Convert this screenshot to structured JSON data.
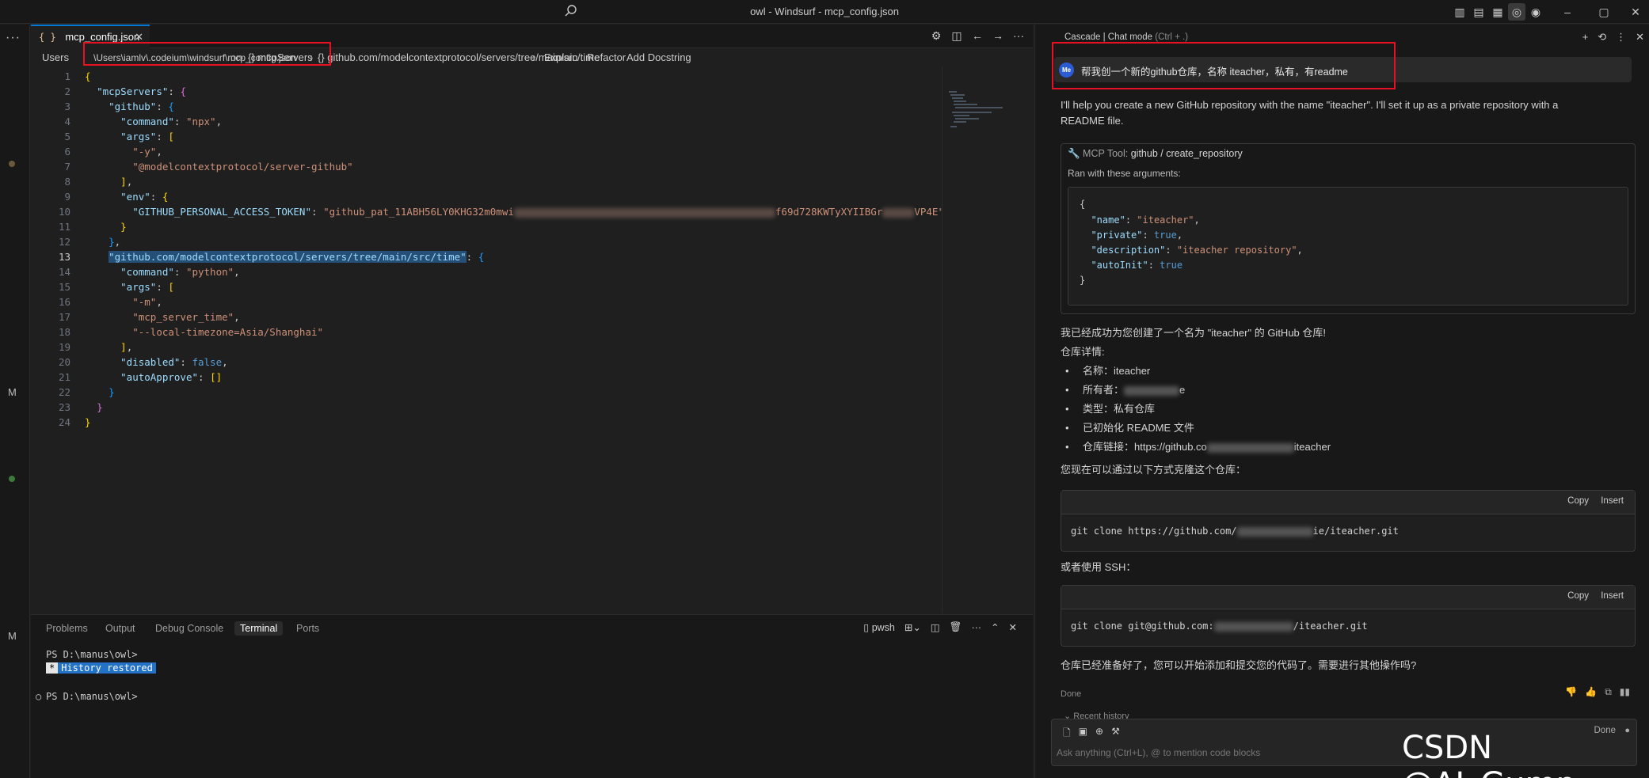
{
  "titlebar": {
    "title": "owl - Windsurf - mcp_config.json"
  },
  "activity": {
    "markers": [
      "M",
      "M"
    ]
  },
  "editor": {
    "tab": {
      "icon": "{ }",
      "label": "mcp_config.json",
      "close": "✕"
    },
    "breadcrumbs": {
      "users": "Users",
      "path_highlight": "\\Users\\iamlv\\.codeium\\windsurf\\mcp_config.json",
      "on_suffix": "on",
      "mcp_servers": "{} mcpServers",
      "time_server": "{} github.com/modelcontextprotocol/servers/tree/main/src/time",
      "explain": "Explain",
      "refactor": "Refactor",
      "add_docstring": "Add Docstring"
    },
    "code": {
      "l1": "{",
      "l2_key": "\"mcpServers\"",
      "l3_key": "\"github\"",
      "l4_key": "\"command\"",
      "l4_val": "\"npx\"",
      "l5_key": "\"args\"",
      "l6_val": "\"-y\"",
      "l7_val": "\"@modelcontextprotocol/server-github\"",
      "l9_key": "\"env\"",
      "l10_key": "\"GITHUB_PERSONAL_ACCESS_TOKEN\"",
      "l10_val_a": "\"github_pat_11ABH56LY0KHG32m0mwi",
      "l10_val_b": "f69d728KWTyXYIIBGr",
      "l10_val_c": "VP4E\"",
      "l13_key": "\"github.com/modelcontextprotocol/servers/tree/main/src/time\"",
      "l14_key": "\"command\"",
      "l14_val": "\"python\"",
      "l15_key": "\"args\"",
      "l16_val": "\"-m\"",
      "l17_val": "\"mcp_server_time\"",
      "l18_val": "\"--local-timezone=Asia/Shanghai\"",
      "l20_key": "\"disabled\"",
      "l20_val": "false",
      "l21_key": "\"autoApprove\"",
      "l21_val": "[]"
    }
  },
  "panel": {
    "tabs": [
      "Problems",
      "Output",
      "Debug Console",
      "Terminal",
      "Ports"
    ],
    "active_tab": "Terminal",
    "shell": "pwsh",
    "prompt1": "PS D:\\manus\\owl>",
    "history_star": "*",
    "history_text": "History restored",
    "prompt2": "PS D:\\manus\\owl>"
  },
  "chat": {
    "header": "Cascade | Chat mode",
    "header_hint": "(Ctrl + .)",
    "avatar": "Me",
    "user_message": "帮我创一个新的github仓库，名称 iteacher，私有，有readme",
    "reply1_line1": "I'll help you create a new GitHub repository with the name \"iteacher\". I'll set it up as a private repository with a",
    "reply1_line2": "README file.",
    "tool_prefix": "MCP Tool:",
    "tool_name": "github / create_repository",
    "ran_with": "Ran with these arguments:",
    "args": {
      "open": "{",
      "name_key": "\"name\"",
      "name_val": "\"iteacher\"",
      "private_key": "\"private\"",
      "private_val": "true",
      "desc_key": "\"description\"",
      "desc_val": "\"iteacher repository\"",
      "autoinit_key": "\"autoInit\"",
      "autoinit_val": "true",
      "close": "}"
    },
    "success": "我已经成功为您创建了一个名为 \"iteacher\" 的 GitHub 仓库!",
    "details_title": "仓库详情:",
    "details": [
      "名称：iteacher",
      "所有者：",
      "类型：私有仓库",
      "已初始化 README 文件",
      "仓库链接：https://github.co"
    ],
    "owner_suffix": "e",
    "link_suffix": "iteacher",
    "clone_intro": "您现在可以通过以下方式克隆这个仓库：",
    "copy": "Copy",
    "insert": "Insert",
    "clone_https_a": "git clone https://github.com/",
    "clone_https_b": "ie/iteacher.git",
    "ssh_intro": "或者使用 SSH：",
    "clone_ssh_a": "git clone git@github.com:",
    "clone_ssh_b": "/iteacher.git",
    "closing": "仓库已经准备好了，您可以开始添加和提交您的代码了。需要进行其他操作吗?",
    "status": "Done",
    "recent_history": "Recent history",
    "done_label": "Done",
    "input_placeholder": "Ask anything (Ctrl+L), @ to mention code blocks"
  },
  "watermark": "CSDN @AI_Gump"
}
